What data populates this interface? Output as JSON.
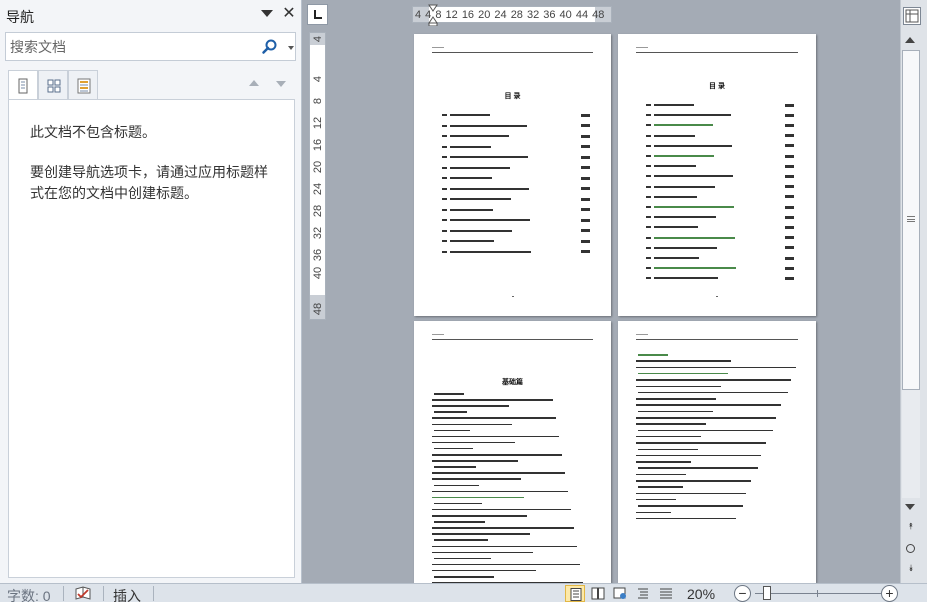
{
  "nav": {
    "title": "导航",
    "search_placeholder": "搜索文档",
    "empty_message_1": "此文档不包含标题。",
    "empty_message_2": "要创建导航选项卡，请通过应用标题样式在您的文档中创建标题。"
  },
  "ruler": {
    "horizontal_numbers": "4  4 8 12 16 20 24 28 32 36 40 44 48",
    "vertical_numbers": [
      "4",
      "4",
      "8",
      "12",
      "16",
      "20",
      "24",
      "28",
      "32",
      "36",
      "40",
      "48"
    ]
  },
  "pages": {
    "toc_title_1": "目 录",
    "toc_title_2": "目 录",
    "body_title_3": "基础篇"
  },
  "status": {
    "word_count": "字数: 0",
    "insert_mode": "插入",
    "zoom_level": "20%"
  },
  "colors": {
    "accent": "#fde9a8",
    "page_background": "#a4abb5",
    "nav_background": "#f3f5f8"
  }
}
